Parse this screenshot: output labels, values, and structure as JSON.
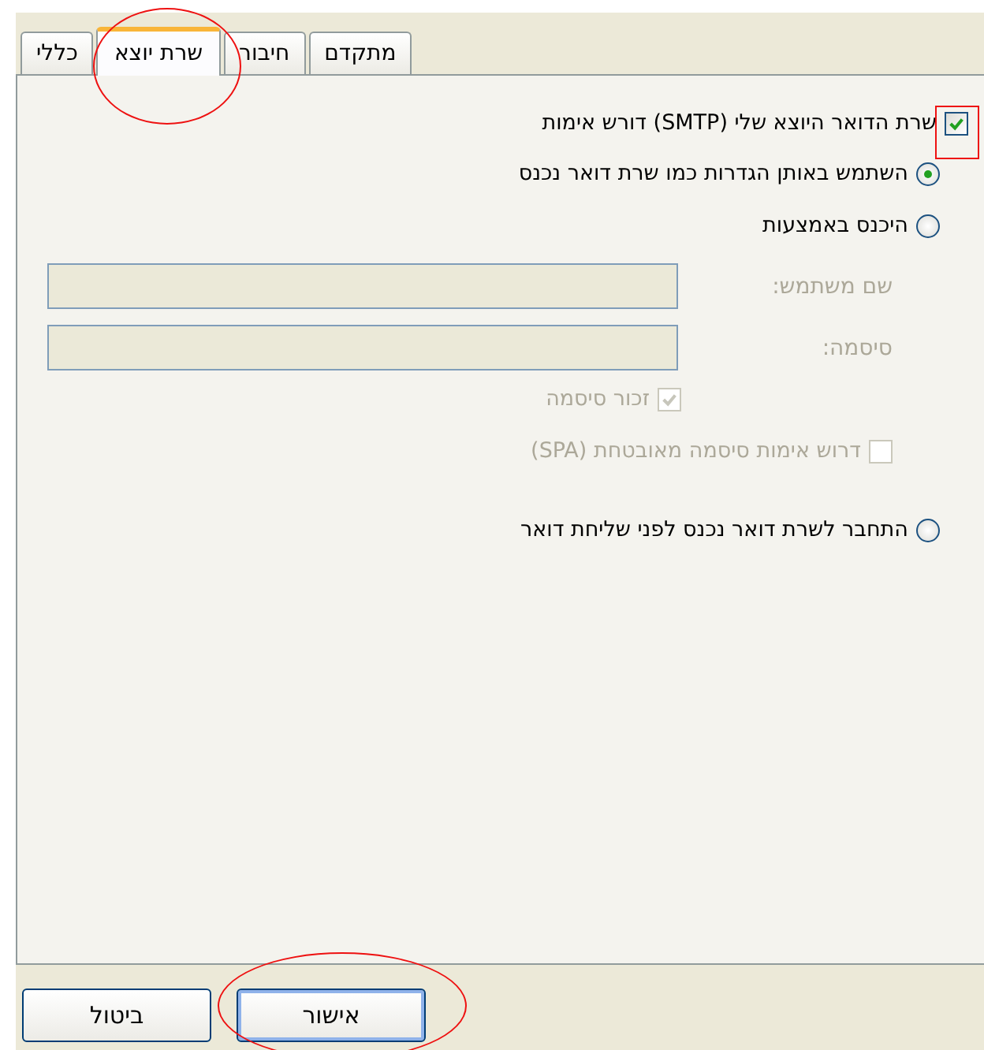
{
  "tabs": [
    {
      "label": "מתקדם",
      "selected": false,
      "circled": false
    },
    {
      "label": "חיבור",
      "selected": false,
      "circled": false
    },
    {
      "label": "שרת יוצא",
      "selected": true,
      "circled": true
    },
    {
      "label": "כללי",
      "selected": false,
      "circled": false
    }
  ],
  "auth_required": {
    "label": "שרת הדואר היוצא שלי (SMTP) דורש אימות",
    "checked": true,
    "boxed": true
  },
  "methods": [
    {
      "label": "השתמש באותן הגדרות כמו שרת דואר נכנס",
      "selected": true
    },
    {
      "label": "היכנס באמצעות",
      "selected": false
    },
    {
      "label": "התחבר לשרת דואר נכנס לפני שליחת דואר",
      "selected": false
    }
  ],
  "credentials": {
    "username": {
      "label": "שם משתמש:",
      "disabled": true
    },
    "password": {
      "label": "סיסמה:",
      "disabled": true
    },
    "remember_password": {
      "label": "זכור סיסמה",
      "checked": true,
      "disabled": true
    },
    "spa": {
      "label": "דרוש אימות סיסמה מאובטחת (SPA)",
      "checked": false,
      "disabled": true
    }
  },
  "buttons": [
    {
      "label": "אישור",
      "default": true,
      "circled": true
    },
    {
      "label": "ביטול",
      "default": false,
      "circled": false
    }
  ]
}
